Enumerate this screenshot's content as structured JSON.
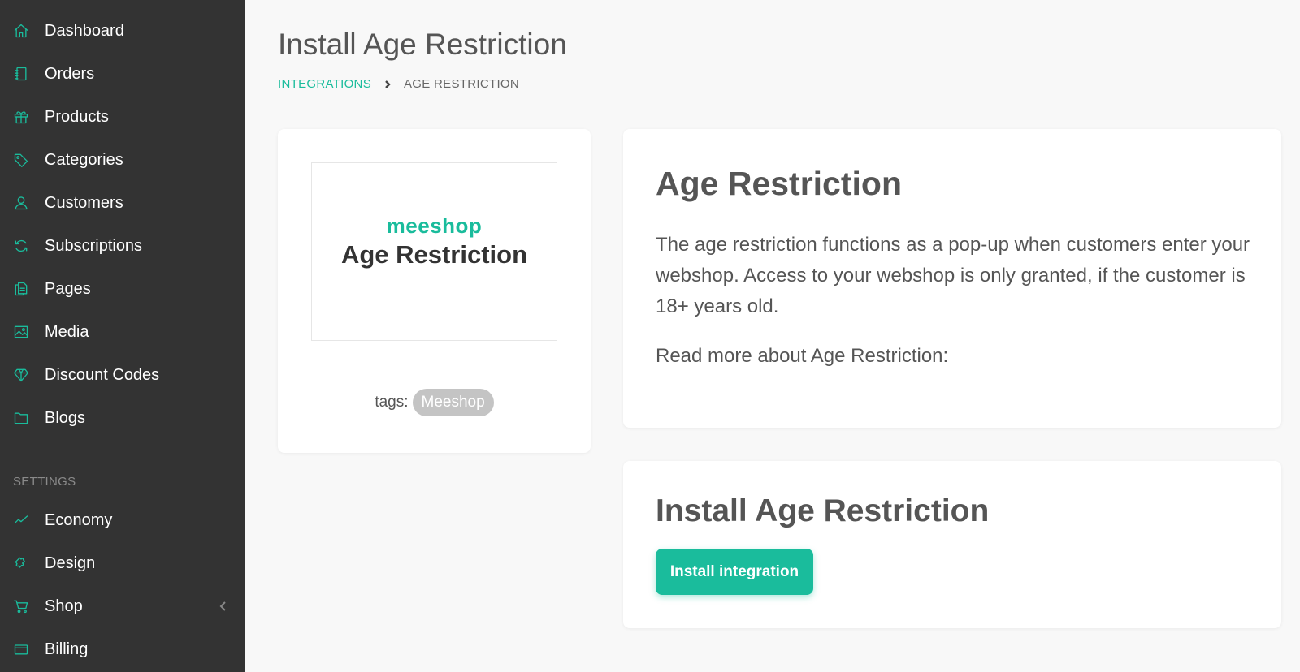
{
  "sidebar": {
    "items": [
      {
        "label": "Dashboard",
        "icon": "home-icon"
      },
      {
        "label": "Orders",
        "icon": "notebook-icon"
      },
      {
        "label": "Products",
        "icon": "gift-icon"
      },
      {
        "label": "Categories",
        "icon": "tag-icon"
      },
      {
        "label": "Customers",
        "icon": "user-icon"
      },
      {
        "label": "Subscriptions",
        "icon": "refresh-icon"
      },
      {
        "label": "Pages",
        "icon": "pages-icon"
      },
      {
        "label": "Media",
        "icon": "image-icon"
      },
      {
        "label": "Discount Codes",
        "icon": "diamond-icon"
      },
      {
        "label": "Blogs",
        "icon": "folder-icon"
      }
    ],
    "settings_label": "SETTINGS",
    "settings_items": [
      {
        "label": "Economy",
        "icon": "chart-line-icon"
      },
      {
        "label": "Design",
        "icon": "puzzle-icon"
      },
      {
        "label": "Shop",
        "icon": "cart-icon"
      },
      {
        "label": "Billing",
        "icon": "credit-card-icon"
      }
    ]
  },
  "header": {
    "title": "Install Age Restriction",
    "breadcrumb": {
      "parent": "INTEGRATIONS",
      "current": "AGE RESTRICTION"
    }
  },
  "logo_card": {
    "brand": "meeshop",
    "logo_title": "Age Restriction",
    "tags_label": "tags:",
    "tag": "Meeshop"
  },
  "info_card": {
    "title": "Age Restriction",
    "description": "The age restriction functions as a pop-up when customers enter your webshop. Access to your webshop is only granted, if the customer is 18+ years old.",
    "read_more": "Read more about Age Restriction:"
  },
  "install_card": {
    "title": "Install Age Restriction",
    "button_label": "Install integration"
  },
  "colors": {
    "accent": "#1abc9c",
    "sidebar_bg": "#333333",
    "page_bg": "#f8f8f8"
  }
}
